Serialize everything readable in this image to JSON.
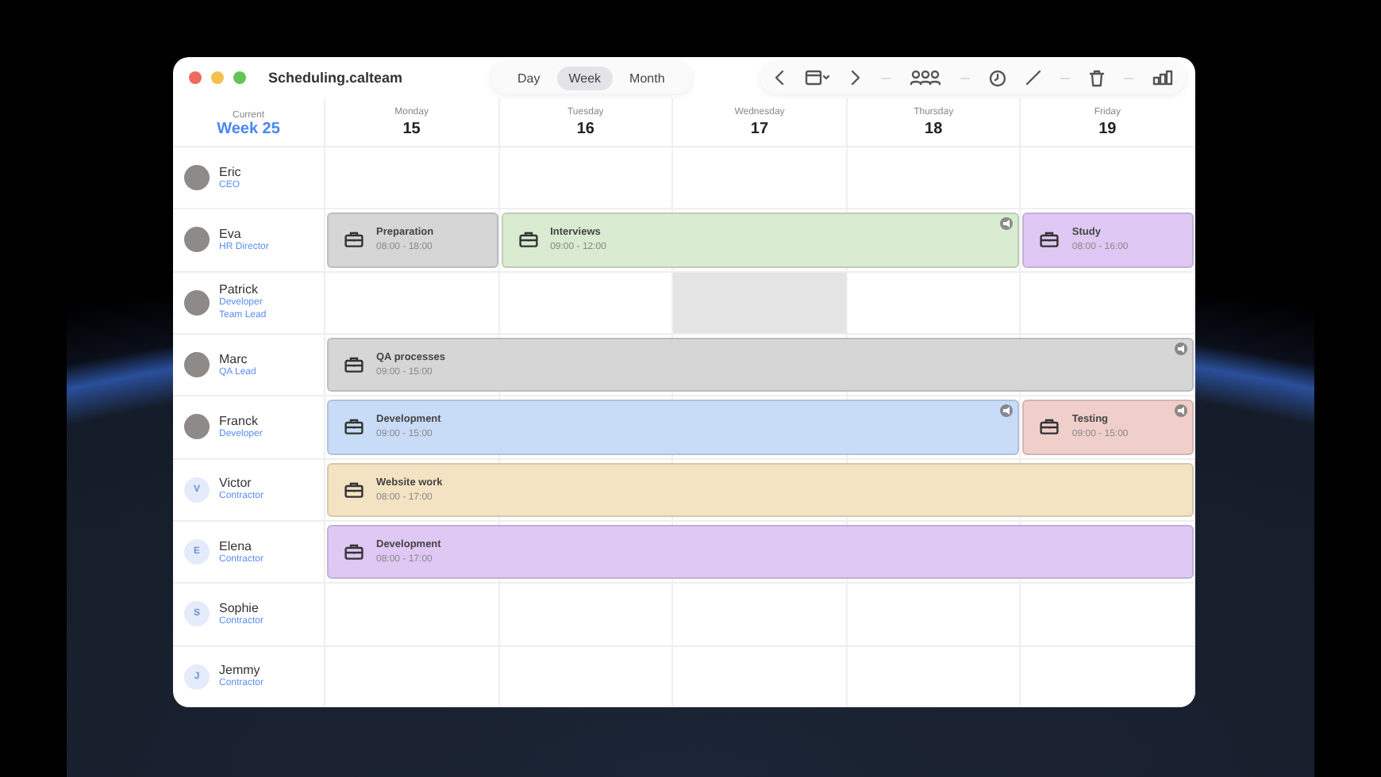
{
  "window": {
    "title": "Scheduling.calteam"
  },
  "views": [
    {
      "label": "Day",
      "selected": false
    },
    {
      "label": "Week",
      "selected": true
    },
    {
      "label": "Month",
      "selected": false
    }
  ],
  "header": {
    "caption": "Current",
    "week": "Week 25"
  },
  "days": [
    {
      "name": "Monday",
      "number": "15"
    },
    {
      "name": "Tuesday",
      "number": "16"
    },
    {
      "name": "Wednesday",
      "number": "17"
    },
    {
      "name": "Thursday",
      "number": "18"
    },
    {
      "name": "Friday",
      "number": "19"
    }
  ],
  "people": [
    {
      "name": "Eric",
      "roles": [
        "CEO"
      ],
      "avatar": {
        "kind": "photo"
      },
      "slots": [
        {
          "kind": "empty"
        },
        {
          "kind": "empty"
        },
        {
          "kind": "empty"
        },
        {
          "kind": "empty"
        },
        {
          "kind": "empty"
        }
      ]
    },
    {
      "name": "Eva",
      "roles": [
        "HR Director"
      ],
      "avatar": {
        "kind": "photo"
      },
      "slots": [
        {
          "kind": "event",
          "title": "Preparation",
          "time": "08:00 - 18:00",
          "color": "#d6d6d6"
        },
        {
          "kind": "event",
          "title": "Interviews",
          "time": "09:00 - 12:00",
          "color": "#d9ebd0",
          "badge": true
        },
        {
          "kind": "continued"
        },
        {
          "kind": "continued"
        },
        {
          "kind": "event",
          "title": "Study",
          "time": "08:00 - 16:00",
          "color": "#dfc8f3"
        }
      ]
    },
    {
      "name": "Patrick",
      "roles": [
        "Developer",
        "Team Lead"
      ],
      "avatar": {
        "kind": "photo"
      },
      "slots": [
        {
          "kind": "empty"
        },
        {
          "kind": "empty"
        },
        {
          "kind": "unavailable"
        },
        {
          "kind": "empty"
        },
        {
          "kind": "empty"
        }
      ]
    },
    {
      "name": "Marc",
      "roles": [
        "QA Lead"
      ],
      "avatar": {
        "kind": "photo"
      },
      "slots": [
        {
          "kind": "event",
          "title": "QA processes",
          "time": "09:00 - 15:00",
          "color": "#d6d6d6",
          "badge": true
        },
        {
          "kind": "continued"
        },
        {
          "kind": "continued"
        },
        {
          "kind": "continued"
        },
        {
          "kind": "continued"
        }
      ]
    },
    {
      "name": "Franck",
      "roles": [
        "Developer"
      ],
      "avatar": {
        "kind": "photo"
      },
      "slots": [
        {
          "kind": "event",
          "title": "Development",
          "time": "09:00 - 15:00",
          "color": "#c9dcf7",
          "badge": true
        },
        {
          "kind": "continued"
        },
        {
          "kind": "continued"
        },
        {
          "kind": "continued"
        },
        {
          "kind": "event",
          "title": "Testing",
          "time": "09:00 - 15:00",
          "color": "#f0cfcb",
          "badge": true
        }
      ]
    },
    {
      "name": "Victor",
      "roles": [
        "Contractor"
      ],
      "avatar": {
        "kind": "initial",
        "text": "V"
      },
      "slots": [
        {
          "kind": "event",
          "title": "Website work",
          "time": "08:00 - 17:00",
          "color": "#f3e3c3"
        },
        {
          "kind": "continued"
        },
        {
          "kind": "continued"
        },
        {
          "kind": "continued"
        },
        {
          "kind": "continued"
        }
      ]
    },
    {
      "name": "Elena",
      "roles": [
        "Contractor"
      ],
      "avatar": {
        "kind": "initial",
        "text": "E"
      },
      "slots": [
        {
          "kind": "event",
          "title": "Development",
          "time": "08:00 - 17:00",
          "color": "#dfc8f3"
        },
        {
          "kind": "continued"
        },
        {
          "kind": "continued"
        },
        {
          "kind": "continued"
        },
        {
          "kind": "continued"
        }
      ]
    },
    {
      "name": "Sophie",
      "roles": [
        "Contractor"
      ],
      "avatar": {
        "kind": "initial",
        "text": "S"
      },
      "slots": [
        {
          "kind": "empty"
        },
        {
          "kind": "empty"
        },
        {
          "kind": "empty"
        },
        {
          "kind": "empty"
        },
        {
          "kind": "empty"
        }
      ]
    },
    {
      "name": "Jemmy",
      "roles": [
        "Contractor"
      ],
      "avatar": {
        "kind": "initial",
        "text": "J"
      },
      "slots": [
        {
          "kind": "empty"
        },
        {
          "kind": "empty"
        },
        {
          "kind": "empty"
        },
        {
          "kind": "empty"
        },
        {
          "kind": "empty"
        }
      ]
    }
  ]
}
